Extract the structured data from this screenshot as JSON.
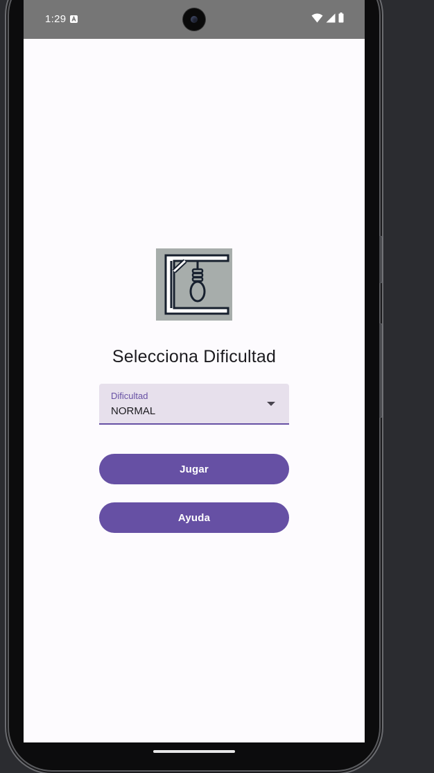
{
  "status_bar": {
    "time": "1:29",
    "icons": [
      "a-notification-icon",
      "wifi-icon",
      "signal-icon",
      "battery-icon"
    ]
  },
  "screen": {
    "logo_icon": "gallows-noose-icon",
    "title": "Selecciona Dificultad",
    "dropdown": {
      "label": "Dificultad",
      "value": "NORMAL"
    },
    "buttons": {
      "play_label": "Jugar",
      "help_label": "Ayuda"
    }
  },
  "colors": {
    "primary": "#6650a4",
    "background": "#fdfbfe",
    "dropdown_fill": "#e7e0ec",
    "status_bar": "#767676"
  }
}
